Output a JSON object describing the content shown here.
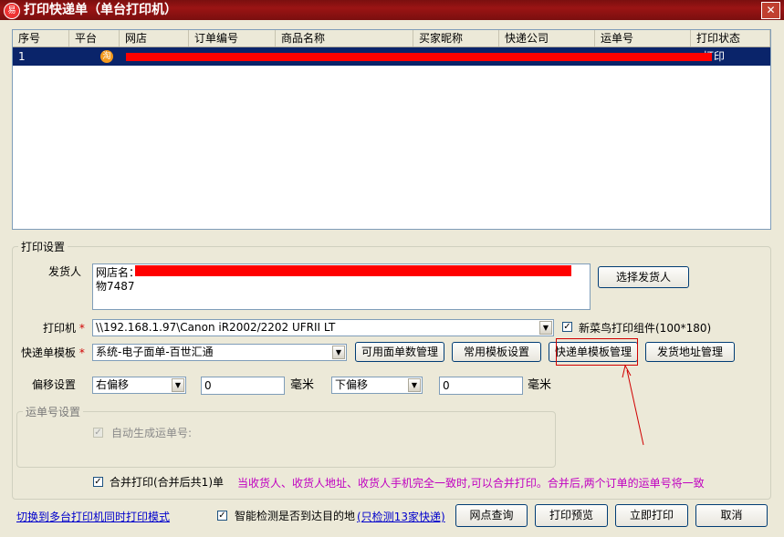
{
  "window": {
    "title": "打印快递单（单台打印机）",
    "app_icon": "易",
    "close": "✕"
  },
  "grid": {
    "columns": [
      "序号",
      "平台",
      "网店",
      "订单编号",
      "商品名称",
      "买家昵称",
      "快递公司",
      "运单号",
      "打印状态"
    ],
    "rows": [
      {
        "index": "1",
        "platform_icon": "淘",
        "status": "打印"
      }
    ]
  },
  "print_settings": {
    "group_label": "打印设置",
    "sender": {
      "label": "发货人",
      "line1": "网店名：",
      "line2": "物7487",
      "select_button": "选择发货人"
    },
    "printer": {
      "label": "打印机",
      "value": "\\\\192.168.1.97\\Canon iR2002/2202 UFRII LT",
      "cainiao_label": "新菜鸟打印组件(100*180)",
      "cainiao_checked": true
    },
    "template": {
      "label": "快递单模板",
      "value": "系统-电子面单-百世汇通",
      "buttons": [
        "可用面单数管理",
        "常用模板设置",
        "快递单模板管理",
        "发货地址管理"
      ]
    },
    "offset": {
      "label": "偏移设置",
      "horizontal": "右偏移",
      "horizontal_value": "0",
      "unit1": "毫米",
      "vertical": "下偏移",
      "vertical_value": "0",
      "unit2": "毫米"
    },
    "waybill": {
      "group_label": "运单号设置",
      "auto_label": "自动生成运单号:"
    },
    "merge": {
      "label": "合并打印(合并后共1)单",
      "checked": true,
      "note": "当收货人、收货人地址、收货人手机完全一致时,可以合并打印。合并后,两个订单的运单号将一致"
    }
  },
  "footer": {
    "switch_link": "切换到多台打印机同时打印模式",
    "smart_check_label": "智能检测是否到达目的地",
    "smart_check_link": "(只检测13家快递)",
    "smart_checked": true,
    "buttons": [
      "网点查询",
      "打印预览",
      "立即打印",
      "取消"
    ]
  },
  "colors": {
    "titlebar": "#8b1212",
    "selection": "#0a246a",
    "redaction": "#ff0000",
    "note": "#c000c0",
    "link": "#0000cc"
  }
}
